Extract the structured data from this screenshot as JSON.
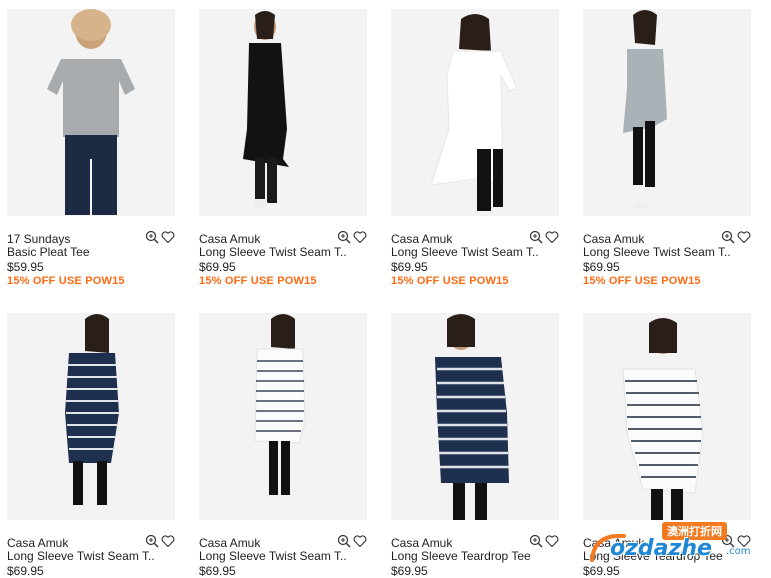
{
  "colors": {
    "promo": "#ff6a13",
    "text": "#222222",
    "tile_bg": "#f3f3f3"
  },
  "products": [
    {
      "brand": "17 Sundays",
      "name": "Basic Pleat Tee",
      "price": "$59.95",
      "promo": "15% OFF USE POW15",
      "garment": "grey-tee"
    },
    {
      "brand": "Casa Amuk",
      "name": "Long Sleeve Twist Seam T..",
      "price": "$69.95",
      "promo": "15% OFF USE POW15",
      "garment": "black-longsleeve"
    },
    {
      "brand": "Casa Amuk",
      "name": "Long Sleeve Twist Seam T..",
      "price": "$69.95",
      "promo": "15% OFF USE POW15",
      "garment": "white-longsleeve"
    },
    {
      "brand": "Casa Amuk",
      "name": "Long Sleeve Twist Seam T..",
      "price": "$69.95",
      "promo": "15% OFF USE POW15",
      "garment": "grey-longsleeve"
    },
    {
      "brand": "Casa Amuk",
      "name": "Long Sleeve Twist Seam T..",
      "price": "$69.95",
      "promo": "",
      "garment": "navy-stripe"
    },
    {
      "brand": "Casa Amuk",
      "name": "Long Sleeve Twist Seam T..",
      "price": "$69.95",
      "promo": "",
      "garment": "white-stripe"
    },
    {
      "brand": "Casa Amuk",
      "name": "Long Sleeve Teardrop Tee",
      "price": "$69.95",
      "promo": "",
      "garment": "navy-stripe"
    },
    {
      "brand": "Casa Amuk",
      "name": "Long Sleeve Teardrop Tee",
      "price": "$69.95",
      "promo": "",
      "garment": "white-stripe"
    }
  ],
  "icons": {
    "quickview": "zoom-icon",
    "wishlist": "heart-icon"
  },
  "watermark": {
    "badge": "澳洲打折网",
    "text": "ozdazhe",
    "suffix": ".com"
  }
}
